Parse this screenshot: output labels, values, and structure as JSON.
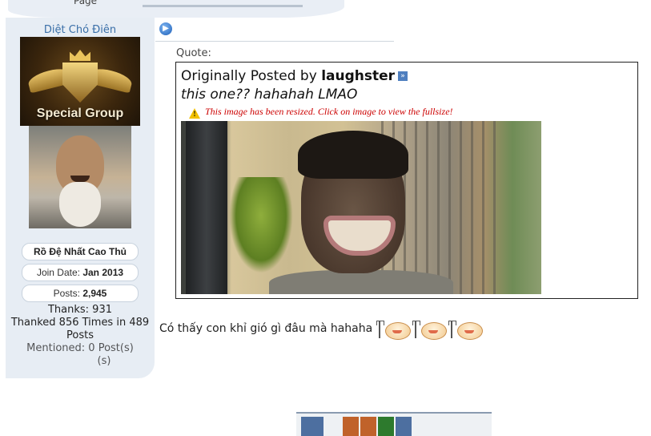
{
  "header_fragment": {
    "text": "Page"
  },
  "user": {
    "username": "Diệt Chó Điên",
    "rank_banner_text": "Special Group",
    "title": "Rồ Đệ Nhất Cao Thủ",
    "join_date_label": "Join Date:",
    "join_date": "Jan 2013",
    "posts_label": "Posts:",
    "posts": "2,945",
    "thanks": "Thanks: 931",
    "thanked_line1": "Thanked 856 Times in 489",
    "thanked_line2": "Posts",
    "mentioned": "Mentioned: 0 Post(s)",
    "tagged_fragment": "(s)"
  },
  "quote": {
    "label": "Quote:",
    "originally_posted_by": "Originally Posted by",
    "author": "laughster",
    "text": "this one?? hahahah LMAO",
    "resize_notice": "This image has been resized. Click on image to view the fullsize!"
  },
  "post": {
    "message": "Có thấy con khỉ gió gì đâu mà hahaha"
  },
  "icons": {
    "post_icon": "arrow-right-circle-icon",
    "view_post": "view-post-icon",
    "warning": "warning-icon",
    "smiley": "pitchfork-smiley-icon"
  },
  "colors": {
    "username": "#3a6fa8",
    "resize_notice": "#cc0000",
    "postbit_bg": "#e7edf4"
  }
}
